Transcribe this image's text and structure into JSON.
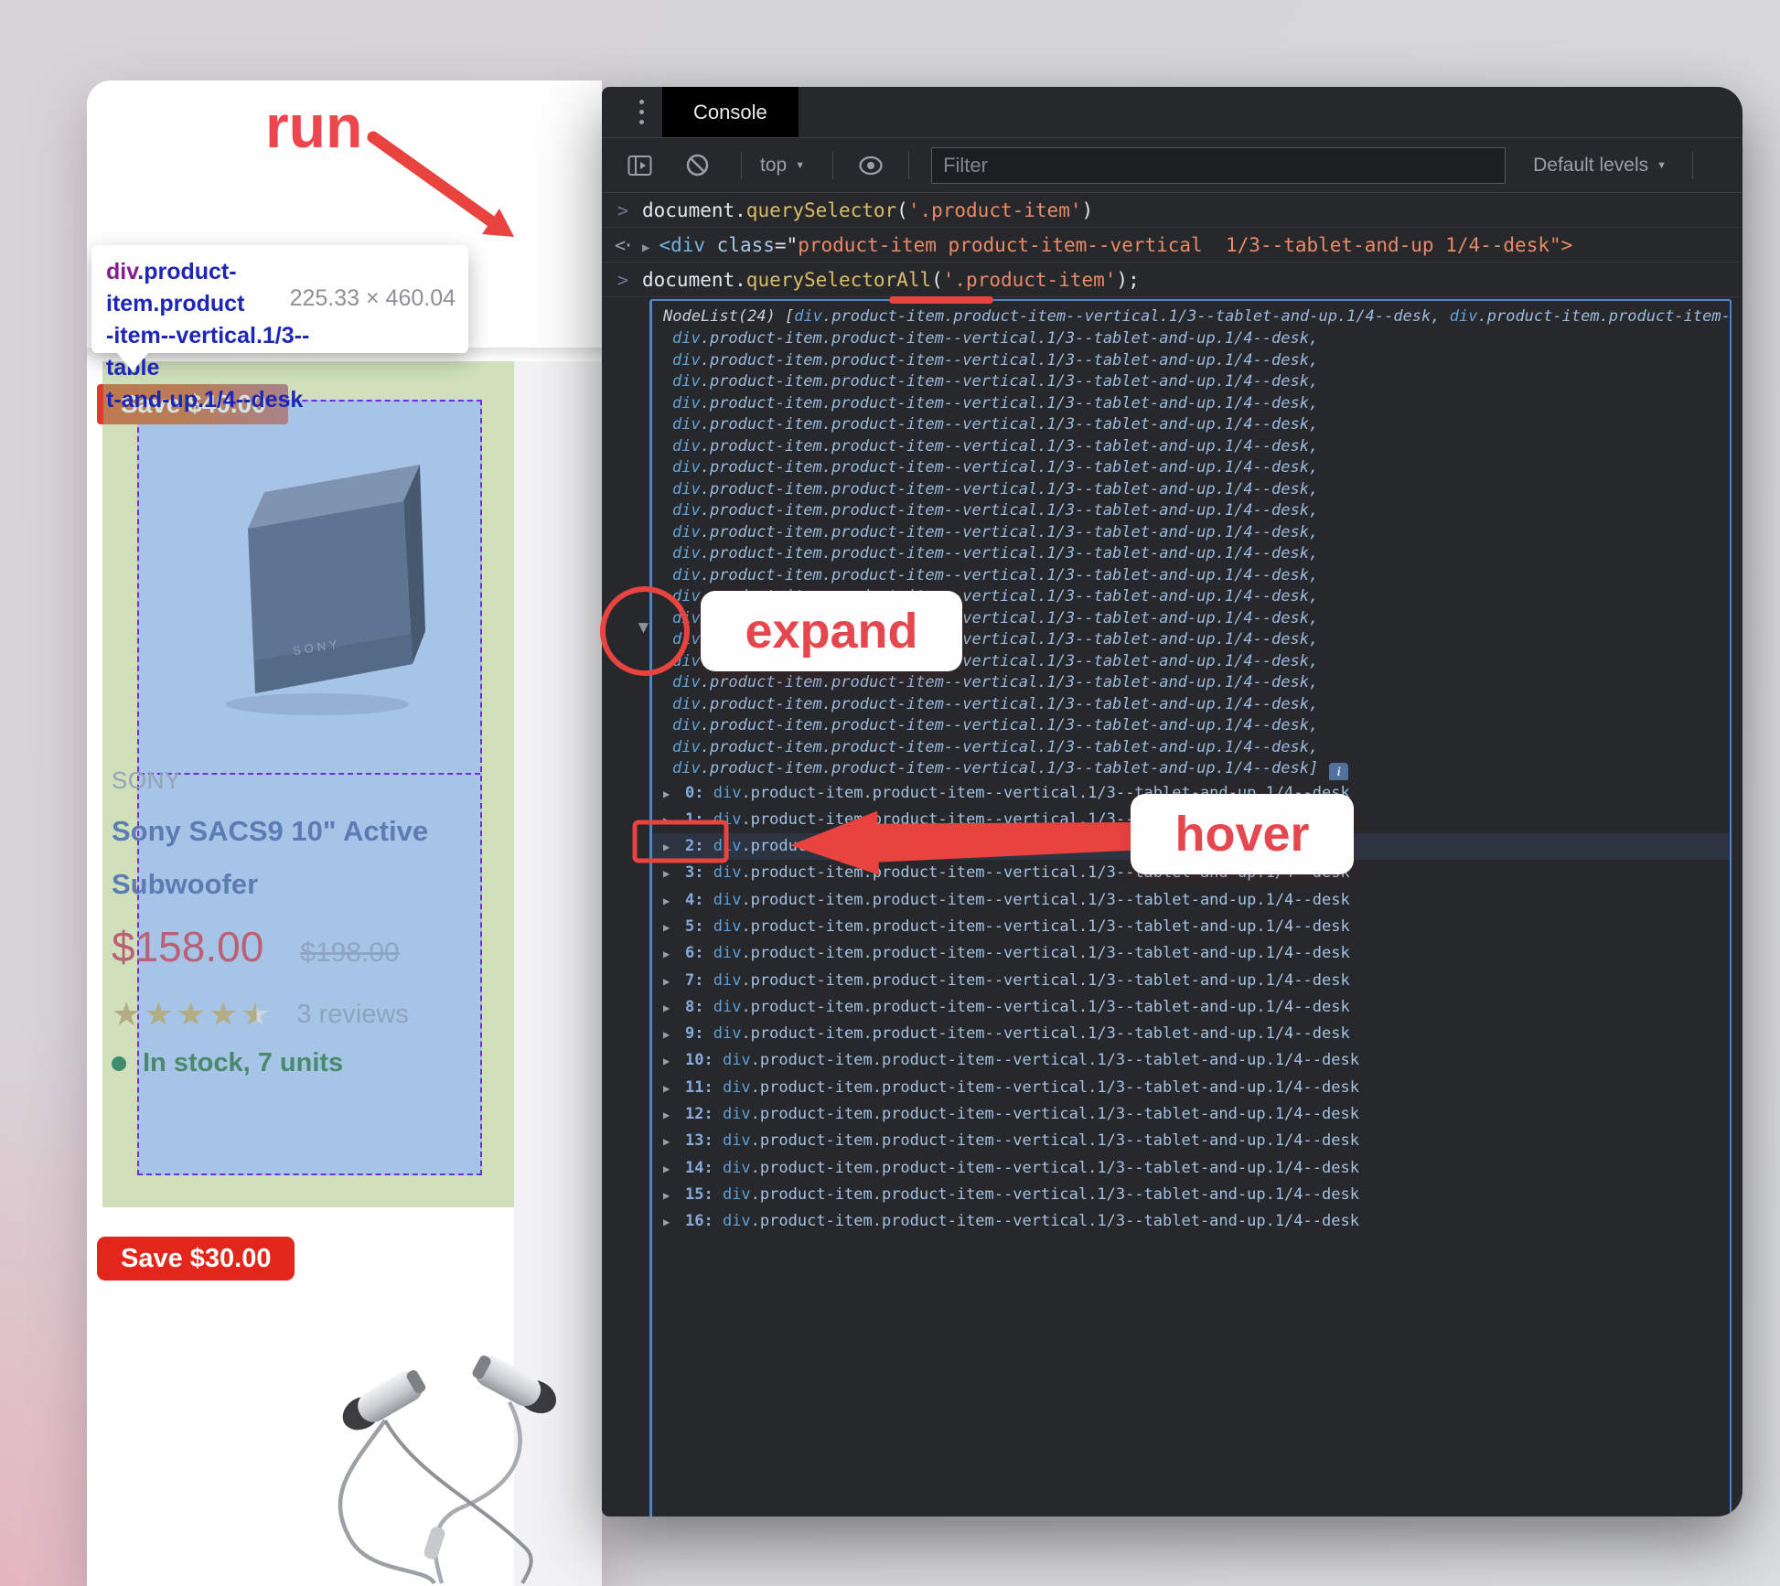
{
  "annotations": {
    "run_label": "run",
    "expand_label": "expand",
    "hover_label": "hover",
    "accent_color": "#e8433f"
  },
  "inspect_tooltip": {
    "tag": "div",
    "selector_line1_rest": ".product-item.product",
    "selector_line2": "-item--vertical.1/3--table",
    "selector_line3": "t-and-up.1/4--desk",
    "dimensions": "225.33 × 460.04"
  },
  "page": {
    "product_card": {
      "badge": "Save $40.00",
      "image_brand": "SONY",
      "brand": "SONY",
      "title_line1": "Sony SACS9 10\" Active",
      "title_line2": "Subwoofer",
      "price": "$158.00",
      "compare_price": "$198.00",
      "rating": "4.5",
      "stars_full": "★★★★",
      "star_half": "★",
      "reviews": "3 reviews",
      "stock": "In stock, 7 units"
    },
    "next_card": {
      "badge": "Save $30.00"
    }
  },
  "devtools": {
    "tab_label": "Console",
    "toolbar": {
      "context_label": "top",
      "filter_placeholder": "Filter",
      "levels_label": "Default levels"
    },
    "console": {
      "cmd1": {
        "object": "document.",
        "fn": "querySelector",
        "paren_open": "(",
        "arg": "'.product-item'",
        "paren_close": ")"
      },
      "result1": {
        "tag": "<div",
        "space": " ",
        "attr": "class",
        "equals": "=\"",
        "value": "product-item product-item--vertical  1/3--tablet-and-up 1/4--desk\">"
      },
      "cmd2": {
        "object": "document.",
        "fn": "querySelector",
        "fn_underlined": "All",
        "paren_open": "(",
        "arg": "'.product-item'",
        "paren_close": ");"
      },
      "nodelist": {
        "length_prefix": "NodeList(24) [",
        "item_tag": "div",
        "item_rest": ".product-item.product-item--vertical.1/3--tablet-and-up.1/4--desk",
        "separator": ", ",
        "visible_preview_lines": 21,
        "close_bracket": "]",
        "info_icon": "i"
      },
      "indexed_rows": {
        "indices": [
          "0",
          "1",
          "2",
          "3",
          "4",
          "5",
          "6",
          "7",
          "8",
          "9",
          "10",
          "11",
          "12",
          "13",
          "14",
          "15",
          "16"
        ],
        "highlighted_index": "2",
        "item_tag": "div",
        "item_rest": ".product-item.product-item--vertical.1/3--tablet-and-up.1/4--desk"
      }
    }
  }
}
